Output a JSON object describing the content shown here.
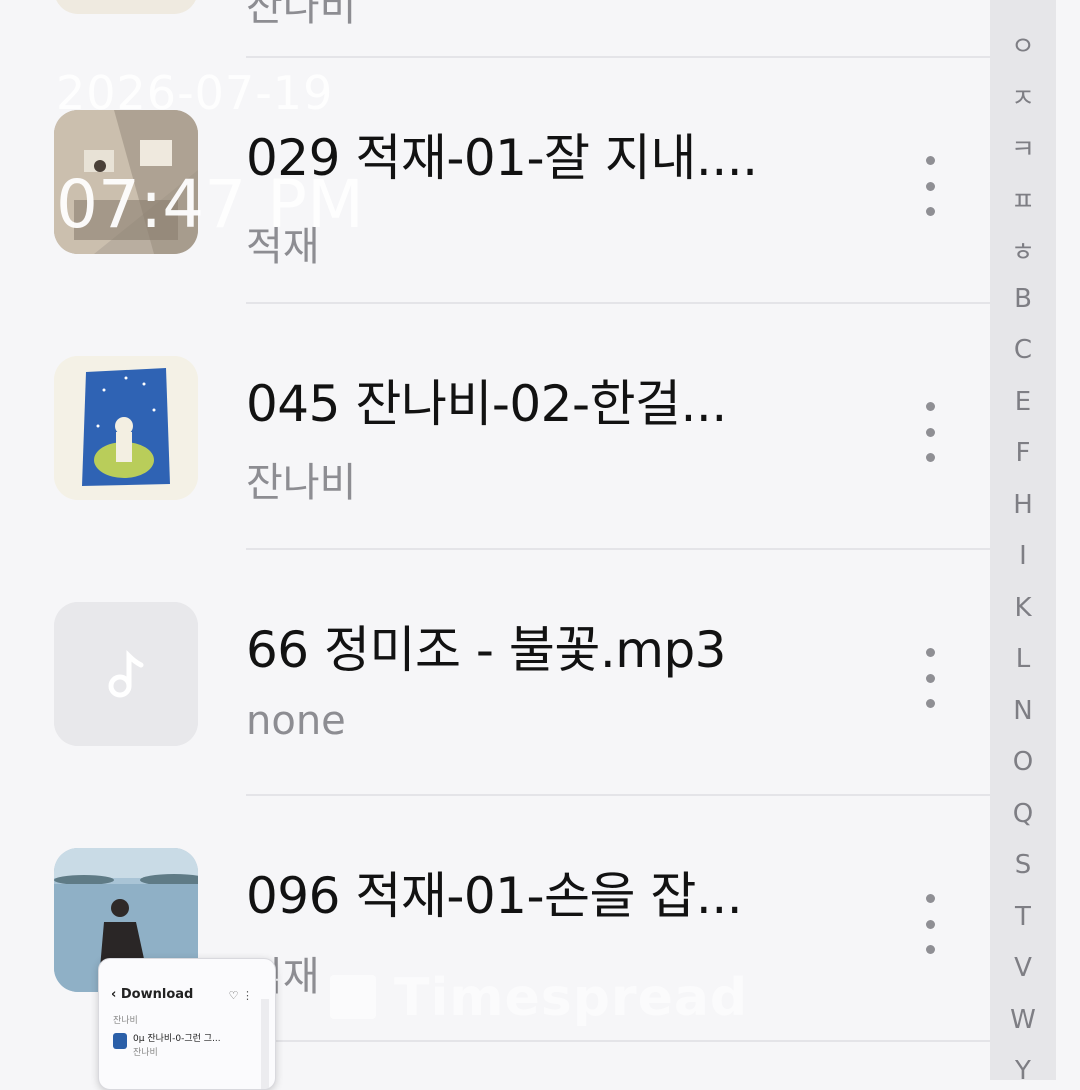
{
  "overlay": {
    "date": "2026-07-19",
    "time": "07:47 PM",
    "watermark": "Timespread"
  },
  "partial_top_item": {
    "artist": "잔나비"
  },
  "songs": [
    {
      "title": "029 적재-01-잘 지내....",
      "artist": "적재",
      "thumbnail": "album-art-photo-room"
    },
    {
      "title": "045 잔나비-02-한걸...",
      "artist": "잔나비",
      "thumbnail": "album-art-illustration-night-sky"
    },
    {
      "title": "66 정미조 - 불꽃.mp3",
      "artist": "none",
      "thumbnail": "music-note-icon"
    },
    {
      "title": "096 적재-01-손을 잡...",
      "artist": "적재",
      "thumbnail": "album-art-photo-sea"
    }
  ],
  "index_letters": [
    "ㅇ",
    "ㅈ",
    "ㅋ",
    "ㅍ",
    "ㅎ",
    "B",
    "C",
    "E",
    "F",
    "H",
    "I",
    "K",
    "L",
    "N",
    "O",
    "Q",
    "S",
    "T",
    "V",
    "W",
    "Y"
  ],
  "mini_preview": {
    "title": "Download",
    "row_1": "잔나비",
    "row_2": "0µ 잔나비-0-그런 그...",
    "row_2_artist": "잔나비"
  },
  "colors": {
    "background": "#f6f6f8",
    "title_text": "#121212",
    "subtitle_text": "#8d8d92",
    "index_bar": "#e6e6e9"
  }
}
